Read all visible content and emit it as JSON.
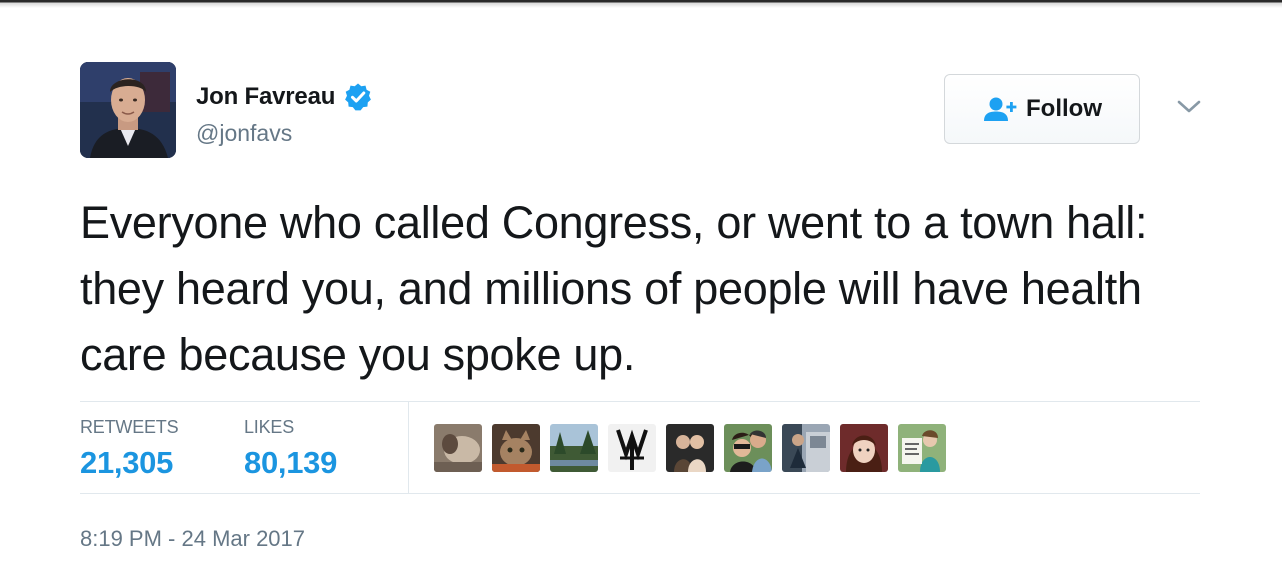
{
  "author": {
    "display_name": "Jon Favreau",
    "handle": "@jonfavs",
    "verified": true,
    "avatar_icon": "user-avatar"
  },
  "follow": {
    "label": "Follow",
    "icon": "follow-user-icon"
  },
  "menu": {
    "icon": "chevron-down-icon"
  },
  "tweet": {
    "text": "Everyone who called Congress, or went to a town hall: they heard you, and millions of people will have health care because you spoke up."
  },
  "stats": {
    "retweets_label": "RETWEETS",
    "retweets_value": "21,305",
    "likes_label": "LIKES",
    "likes_value": "80,139"
  },
  "likers": [
    {
      "icon": "liker-avatar-1"
    },
    {
      "icon": "liker-avatar-2"
    },
    {
      "icon": "liker-avatar-3"
    },
    {
      "icon": "liker-avatar-4"
    },
    {
      "icon": "liker-avatar-5"
    },
    {
      "icon": "liker-avatar-6"
    },
    {
      "icon": "liker-avatar-7"
    },
    {
      "icon": "liker-avatar-8"
    },
    {
      "icon": "liker-avatar-9"
    }
  ],
  "timestamp": "8:19 PM - 24 Mar 2017",
  "colors": {
    "accent": "#1b95e0",
    "verified": "#1da1f2",
    "text": "#14171a",
    "muted": "#657786",
    "divider": "#e1e8ed"
  }
}
